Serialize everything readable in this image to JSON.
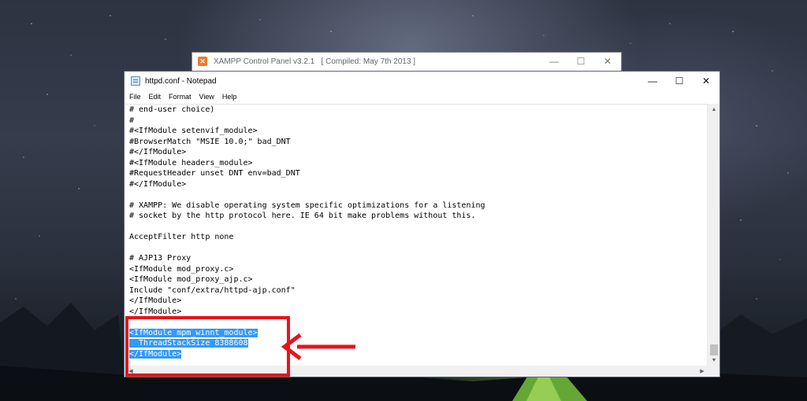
{
  "xampp_window": {
    "title": "XAMPP Control Panel v3.2.1   [ Compiled: May 7th 2013 ]",
    "icon": "xampp-logo-icon"
  },
  "notepad": {
    "title": "httpd.conf - Notepad",
    "icon": "notepad-icon",
    "controls": {
      "minimize": "—",
      "maximize": "☐",
      "close": "✕"
    },
    "menu": [
      "File",
      "Edit",
      "Format",
      "View",
      "Help"
    ],
    "lines": [
      "# end-user choice)",
      "#",
      "#<IfModule setenvif_module>",
      "#BrowserMatch \"MSIE 10.0;\" bad_DNT",
      "#</IfModule>",
      "#<IfModule headers_module>",
      "#RequestHeader unset DNT env=bad_DNT",
      "#</IfModule>",
      "",
      "# XAMPP: We disable operating system specific optimizations for a listening",
      "# socket by the http protocol here. IE 64 bit make problems without this.",
      "",
      "AcceptFilter http none",
      "",
      "# AJP13 Proxy",
      "<IfModule mod_proxy.c>",
      "<IfModule mod_proxy_ajp.c>",
      "Include \"conf/extra/httpd-ajp.conf\"",
      "</IfModule>",
      "</IfModule>",
      "",
      "<IfModule mpm_winnt_module>",
      "  ThreadStackSize 8388608",
      "</IfModule>"
    ],
    "selected_from_line": 21
  },
  "colors": {
    "selection": "#3399ff",
    "annotation": "#e8141c"
  }
}
